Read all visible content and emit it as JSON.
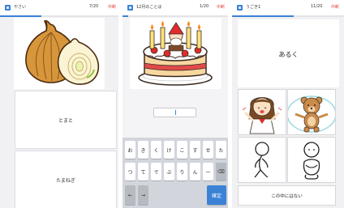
{
  "screen1": {
    "category": "やさい",
    "progress_text": "7/20",
    "progress_fraction": 0.35,
    "quit_label": "中断",
    "picture_icon": "onion-picture",
    "options": [
      "とまと",
      "たまねぎ"
    ]
  },
  "screen2": {
    "category": "12月のことば",
    "progress_text": "1/20",
    "progress_fraction": 0.05,
    "quit_label": "中断",
    "picture_icon": "birthday-cake-picture",
    "answer_value": "",
    "keyboard": {
      "row1": [
        "お",
        "き",
        "く",
        "け",
        "こ",
        "す",
        "せ",
        "た"
      ],
      "row2": [
        "つ",
        "て",
        "で",
        "ぶ",
        "り",
        "ん",
        "ー",
        "⌫"
      ],
      "left_arrow": "←",
      "right_arrow": "→",
      "enter_label": "確定"
    }
  },
  "screen3": {
    "category": "うごき1",
    "progress_text": "11/20",
    "progress_fraction": 0.55,
    "quit_label": "中断",
    "question_word": "あるく",
    "choice_icons": [
      "girl-picture",
      "bear-jump-rope-picture",
      "walking-figure-picture",
      "sitting-figure-picture"
    ],
    "none_label": "この中にはない"
  },
  "colors": {
    "accent": "#3b82d6",
    "quit": "#e0463c",
    "background": "#f1f1f3"
  }
}
